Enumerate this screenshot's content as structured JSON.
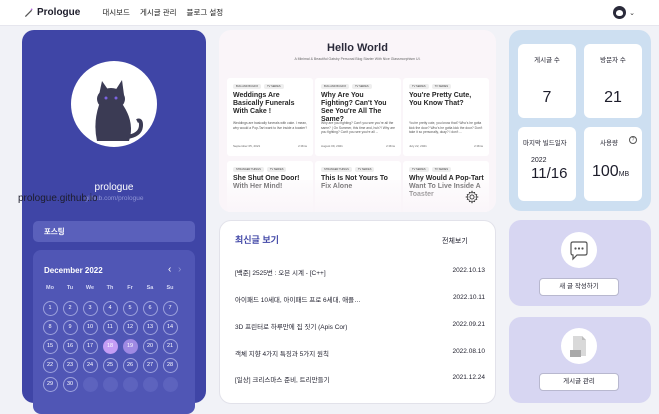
{
  "header": {
    "logo_text": "Prologue",
    "nav": [
      "대시보드",
      "게시글 관리",
      "블로그 설정"
    ]
  },
  "profile": {
    "name": "prologue",
    "url": "github.com/prologue",
    "posting_label": "포스팅"
  },
  "calendar": {
    "title": "December 2022",
    "weekdays": [
      "Mo",
      "Tu",
      "We",
      "Th",
      "Fr",
      "Sa",
      "Su"
    ],
    "days": [
      "1",
      "2",
      "3",
      "4",
      "5",
      "6",
      "7",
      "8",
      "9",
      "10",
      "11",
      "12",
      "13",
      "14",
      "15",
      "16",
      "17",
      "18",
      "19",
      "20",
      "21",
      "22",
      "23",
      "24",
      "25",
      "26",
      "27",
      "28",
      "29",
      "30"
    ],
    "selected_days": [
      18,
      19
    ],
    "start_weekday_index": 0
  },
  "preview": {
    "title": "Hello World",
    "subtitle": "A Minimal & Beautiful Gatsby Personal Blog Starter With Nice Glassmorphism UI.",
    "url": "prologue.github.io",
    "posts": [
      {
        "tags": [
          "BUG AND BUGFIX",
          "TV SERIES"
        ],
        "title": "Weddings Are Basically Funerals With Cake !",
        "desc": "Weddings are basically funerals with cake. I mean, why would a Pop-Tart want to live inside a toaster?",
        "date": "September 05, 2021",
        "min": "2 Mins"
      },
      {
        "tags": [
          "BUG AND BUGFIX",
          "TV SERIES"
        ],
        "title": "Why Are You Fighting? Can't You See You're All The Same?",
        "desc": "Why are you fighting? Can't you see you're all the same? | On Summer, this time and, huh?! Why are you fighting? Can't you see you're all ...",
        "date": "August 09, 2021",
        "min": "2 Mins"
      },
      {
        "tags": [
          "TV SERIES",
          "TV SERIES"
        ],
        "title": "You're Pretty Cute, You Know That?",
        "desc": "You're pretty cute, you know that? Who's he gotta kick the door? Who's he gotta kick the door? Don't take it so personally, okay? I don't ...",
        "date": "July 22, 2021",
        "min": "2 Mins"
      },
      {
        "tags": [
          "STRANGER THINGS",
          "TV SERIES"
        ],
        "title": "She Shut One Door! With Her Mind!",
        "desc": "",
        "date": "",
        "min": ""
      },
      {
        "tags": [
          "STRANGER THINGS",
          "TV SERIES"
        ],
        "title": "This Is Not Yours To Fix Alone",
        "desc": "",
        "date": "",
        "min": ""
      },
      {
        "tags": [
          "TV SERIES",
          "TV SERIES"
        ],
        "title": "Why Would A Pop-Tart Want To Live Inside A Toaster",
        "desc": "",
        "date": "",
        "min": ""
      }
    ]
  },
  "recent": {
    "title": "최신글 보기",
    "view_all": "전체보기",
    "items": [
      {
        "title": "[백준] 2525번 : 오븐 시계 - [C++]",
        "date": "2022.10.13"
      },
      {
        "title": "아이패드 10세대, 아이패드 프로 6세대, 애플…",
        "date": "2022.10.11"
      },
      {
        "title": "3D 프린터로 하루만에 집 짓기 (Apis Cor)",
        "date": "2022.09.21"
      },
      {
        "title": "객체 지향 4가지 특징과 5가지 원칙",
        "date": "2022.08.10"
      },
      {
        "title": "[일상] 크리스마스 준비, 트리만들기",
        "date": "2021.12.24"
      }
    ]
  },
  "stats": {
    "posts_label": "게시글 수",
    "posts_value": "7",
    "visitors_label": "방문자 수",
    "visitors_value": "21",
    "build_label": "마지막 빌드일자",
    "build_year": "2022",
    "build_md": "11/16",
    "usage_label": "사용량",
    "usage_value": "100",
    "usage_unit": "MB",
    "help_glyph": "?"
  },
  "actions": {
    "write_label": "새 글 작성하기",
    "manage_label": "게시글 관리"
  },
  "colors": {
    "primary": "#3f45a6",
    "calendar_bg": "#5056b5",
    "selected_day": "#c59df5",
    "stats_bg": "#cddff1",
    "action_bg": "#d7d6f2"
  }
}
